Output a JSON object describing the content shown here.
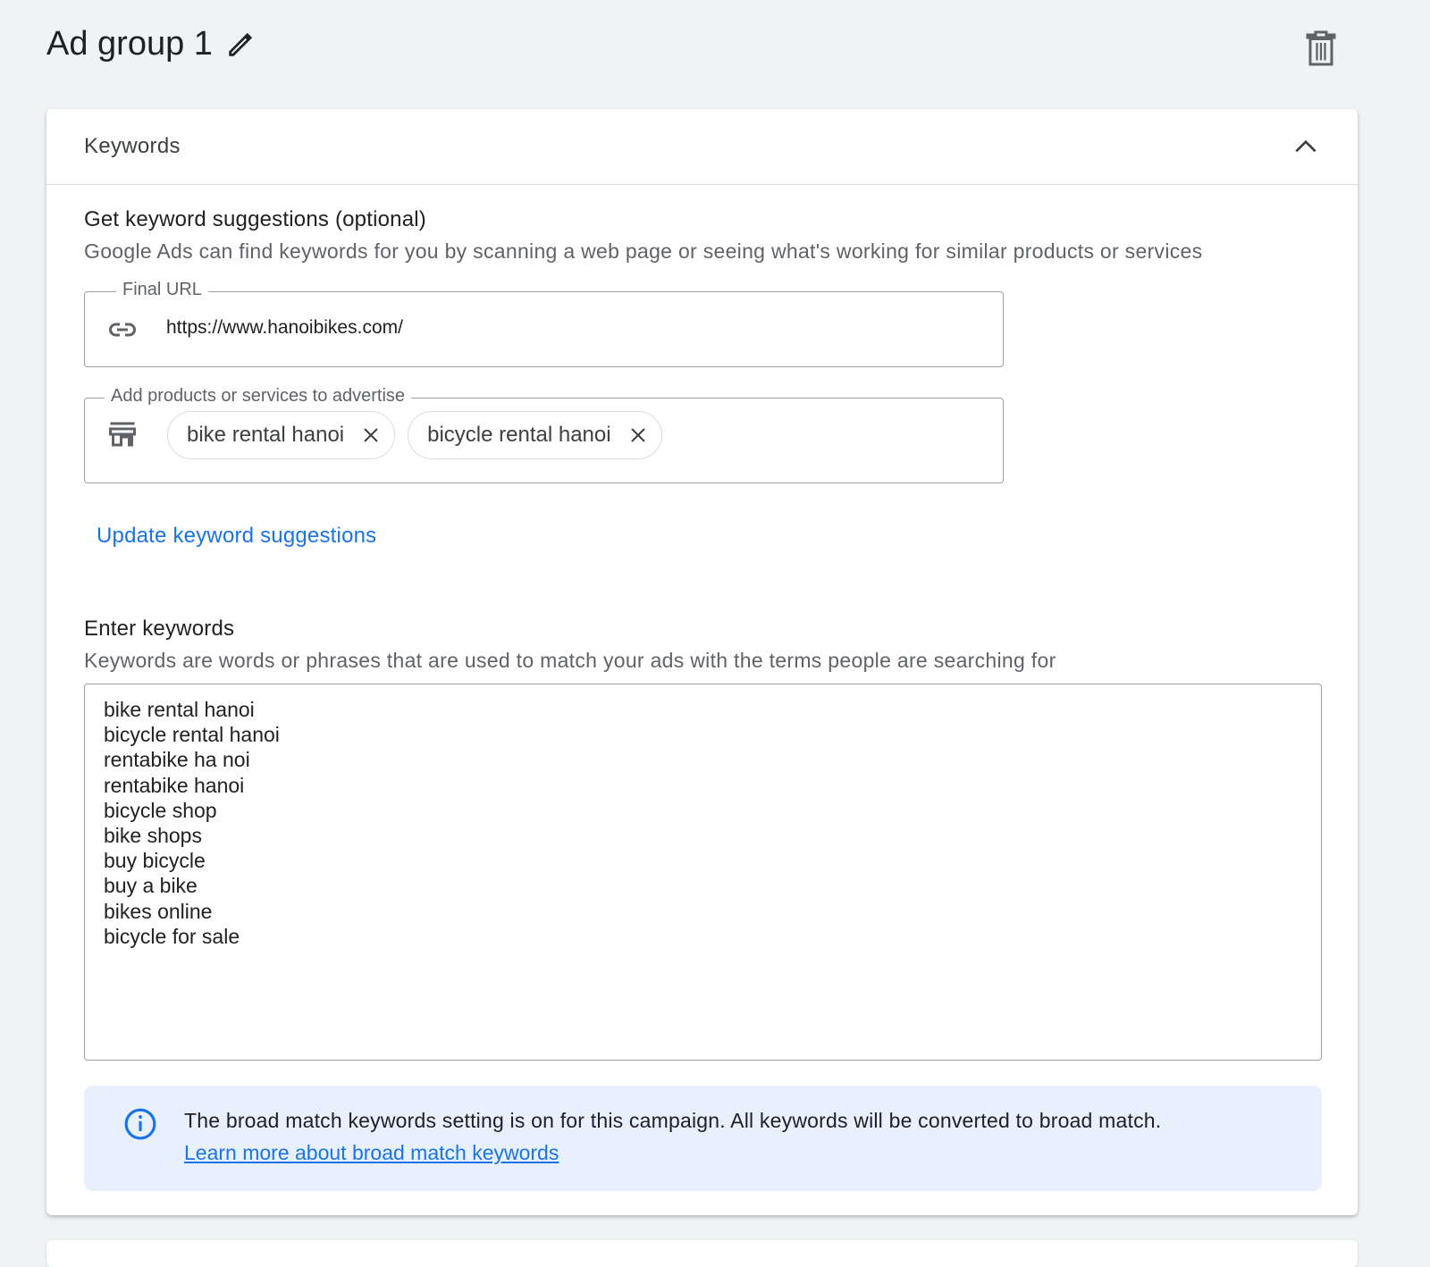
{
  "header": {
    "title": "Ad group 1",
    "edit_icon": "pencil-icon",
    "delete_icon": "trash-icon"
  },
  "keywords_card": {
    "title": "Keywords",
    "collapse_icon": "chevron-up-icon",
    "suggestions": {
      "title": "Get keyword suggestions (optional)",
      "description": "Google Ads can find keywords for you by scanning a web page or seeing what's working for similar products or services",
      "final_url": {
        "label": "Final URL",
        "value": "https://www.hanoibikes.com/",
        "icon": "link-icon"
      },
      "products": {
        "label": "Add products or services to advertise",
        "icon": "store-icon",
        "chips": [
          "bike rental hanoi",
          "bicycle rental hanoi"
        ]
      },
      "update_link": "Update keyword suggestions"
    },
    "enter_keywords": {
      "title": "Enter keywords",
      "description": "Keywords are words or phrases that are used to match your ads with the terms people are searching for",
      "value": "bike rental hanoi\nbicycle rental hanoi\nrentabike ha noi\nrentabike hanoi\nbicycle shop\nbike shops\nbuy bicycle\nbuy a bike\nbikes online\nbicycle for sale"
    },
    "info_banner": {
      "icon": "info-icon",
      "text": "The broad match keywords setting is on for this campaign. All keywords will be converted to broad match.",
      "link": "Learn more about broad match keywords"
    }
  },
  "colors": {
    "accent": "#1a73e8",
    "banner_bg": "#e8f0fe",
    "page_bg": "#f0f3f4"
  }
}
